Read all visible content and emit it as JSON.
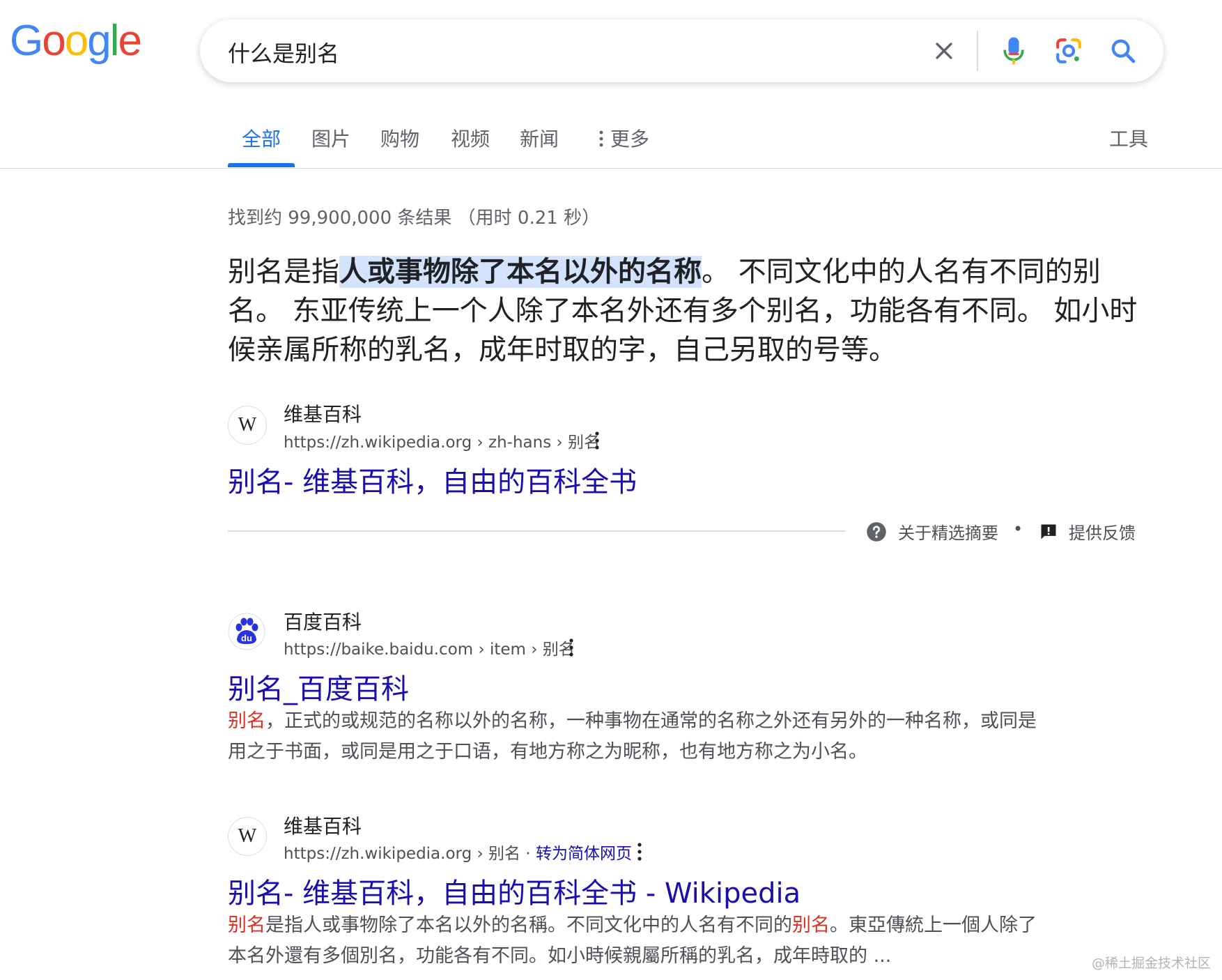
{
  "logo": {
    "letters": [
      "G",
      "o",
      "o",
      "g",
      "l",
      "e"
    ],
    "colors": [
      "#4285f4",
      "#ea4335",
      "#fbbc05",
      "#4285f4",
      "#34a853",
      "#ea4335"
    ]
  },
  "search": {
    "query": "什么是别名"
  },
  "tabs": [
    {
      "label": "全部",
      "active": true
    },
    {
      "label": "图片"
    },
    {
      "label": "购物"
    },
    {
      "label": "视频"
    },
    {
      "label": "新闻"
    },
    {
      "label": "更多"
    }
  ],
  "tools_label": "工具",
  "stats": "找到约 99,900,000 条结果 （用时 0.21 秒）",
  "featured_snippet": {
    "text_before": "别名是指",
    "highlight": "人或事物除了本名以外的名称",
    "text_after": "。 不同文化中的人名有不同的别名。 东亚传统上一个人除了本名外还有多个别名，功能各有不同。 如小时候亲属所称的乳名，成年时取的字，自己另取的号等。",
    "site": "维基百科",
    "url": "https://zh.wikipedia.org › zh-hans › 别名",
    "title": "别名- 维基百科，自由的百科全书",
    "about_label": "关于精选摘要",
    "separator": "•",
    "feedback_label": "提供反馈"
  },
  "results": [
    {
      "site": "百度百科",
      "url": "https://baike.baidu.com › item › 别名",
      "title": "别名_百度百科",
      "desc_em": "别名",
      "desc": "，正式的或规范的名称以外的名称，一种事物在通常的名称之外还有另外的一种名称，或同是用之于书面，或同是用之于口语，有地方称之为昵称，也有地方称之为小名。"
    },
    {
      "site": "维基百科",
      "url": "https://zh.wikipedia.org › 别名 · ",
      "translate": "转为简体网页",
      "title": "别名- 维基百科，自由的百科全书 - Wikipedia",
      "desc_em1": "别名",
      "desc_mid": "是指人或事物除了本名以外的名稱。不同文化中的人名有不同的",
      "desc_em2": "别名",
      "desc_end": "。東亞傳統上一個人除了本名外還有多個別名，功能各有不同。如小時候親屬所稱的乳名，成年時取的 ..."
    }
  ],
  "watermark": "@稀土掘金技术社区"
}
